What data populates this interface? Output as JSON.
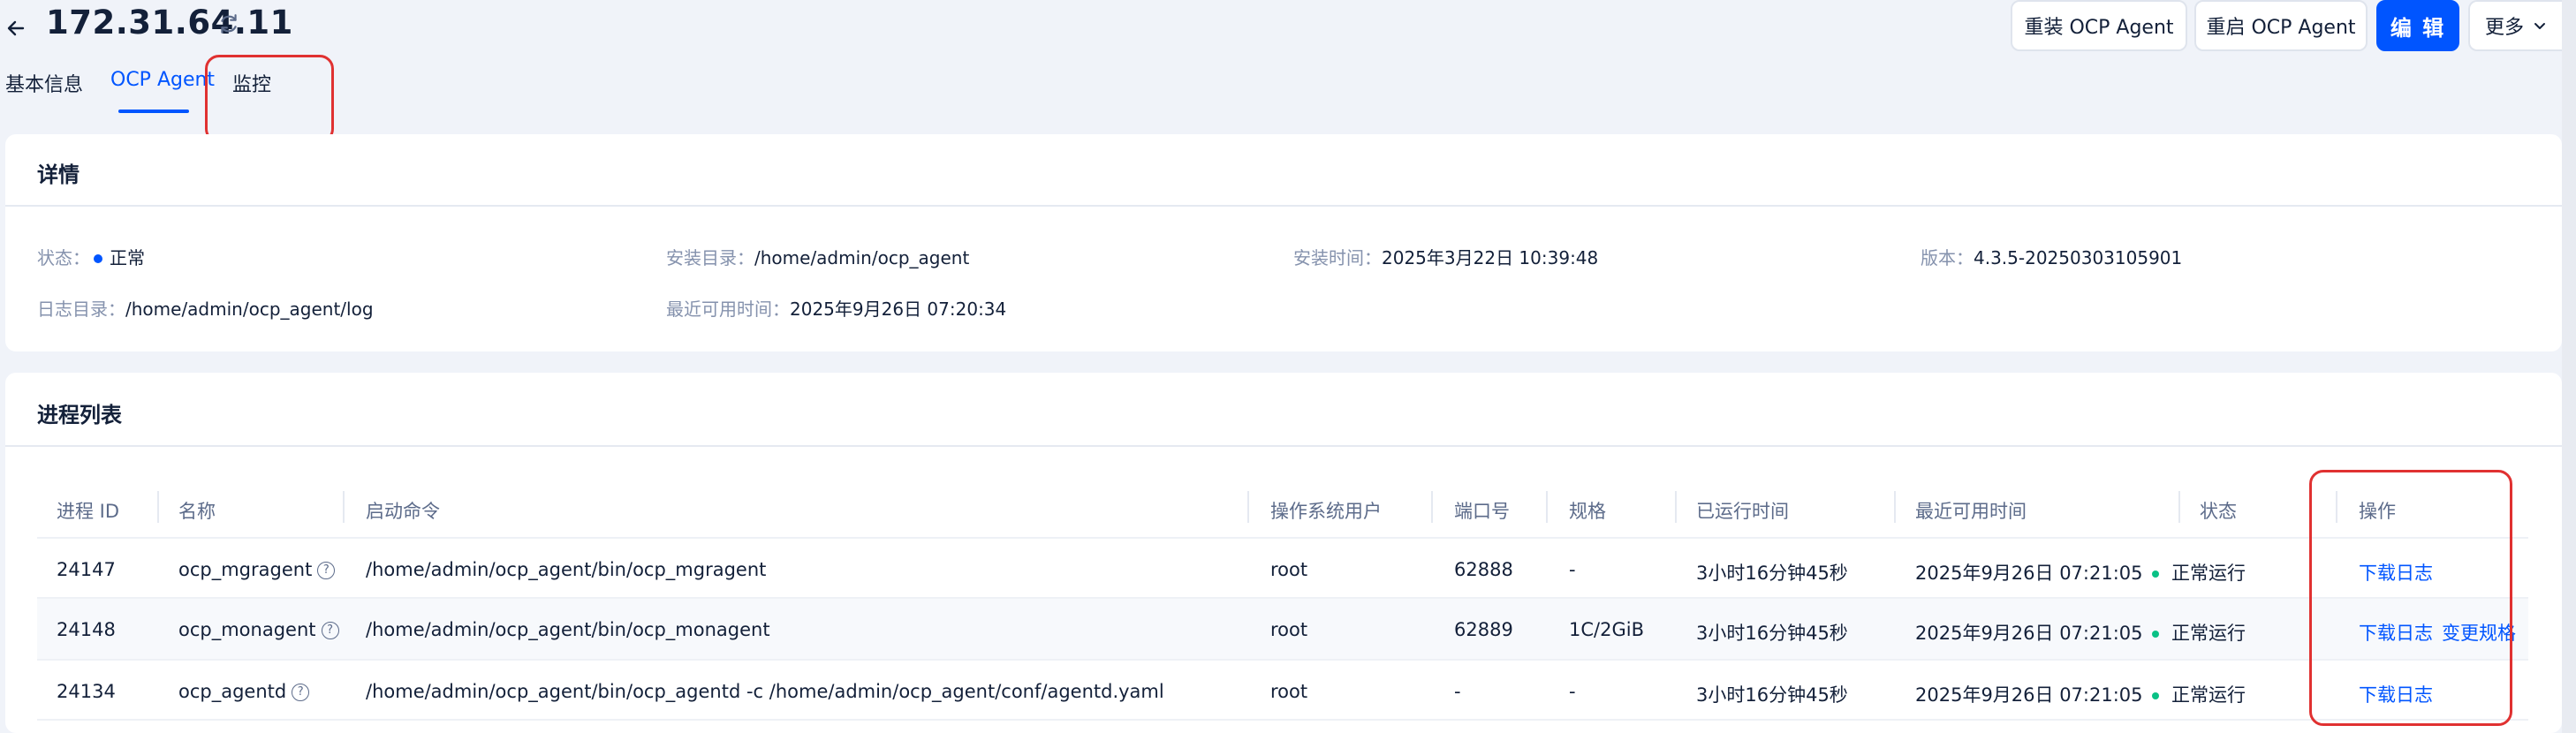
{
  "header": {
    "title": "172.31.64.11",
    "buttons": {
      "reinstall": "重装 OCP Agent",
      "restart": "重启 OCP Agent",
      "edit": "编 辑",
      "more": "更多"
    }
  },
  "tabs": [
    "基本信息",
    "OCP Agent",
    "监控"
  ],
  "details": {
    "title": "详情",
    "status_label": "状态：",
    "status_value": "正常",
    "install_dir_label": "安装目录：",
    "install_dir_value": "/home/admin/ocp_agent",
    "install_time_label": "安装时间：",
    "install_time_value": "2025年3月22日 10:39:48",
    "version_label": "版本：",
    "version_value": "4.3.5-20250303105901",
    "log_dir_label": "日志目录：",
    "log_dir_value": "/home/admin/ocp_agent/log",
    "last_available_label": "最近可用时间：",
    "last_available_value": "2025年9月26日 07:20:34"
  },
  "process_list": {
    "title": "进程列表",
    "columns": [
      "进程 ID",
      "名称",
      "启动命令",
      "操作系统用户",
      "端口号",
      "规格",
      "已运行时间",
      "最近可用时间",
      "状态",
      "操作"
    ],
    "rows": [
      {
        "pid": "24147",
        "name": "ocp_mgragent",
        "command": "/home/admin/ocp_agent/bin/ocp_mgragent",
        "user": "root",
        "port": "62888",
        "spec": "-",
        "uptime": "3小时16分钟45秒",
        "last_available": "2025年9月26日 07:21:05",
        "status": "正常运行",
        "actions": [
          "下载日志"
        ]
      },
      {
        "pid": "24148",
        "name": "ocp_monagent",
        "command": "/home/admin/ocp_agent/bin/ocp_monagent",
        "user": "root",
        "port": "62889",
        "spec": "1C/2GiB",
        "uptime": "3小时16分钟45秒",
        "last_available": "2025年9月26日 07:21:05",
        "status": "正常运行",
        "actions": [
          "下载日志",
          "变更规格"
        ]
      },
      {
        "pid": "24134",
        "name": "ocp_agentd",
        "command": "/home/admin/ocp_agent/bin/ocp_agentd -c /home/admin/ocp_agent/conf/agentd.yaml",
        "user": "root",
        "port": "-",
        "spec": "-",
        "uptime": "3小时16分钟45秒",
        "last_available": "2025年9月26日 07:21:05",
        "status": "正常运行",
        "actions": [
          "下载日志"
        ]
      }
    ]
  },
  "icons": {
    "back": "arrow-left-icon",
    "refresh": "refresh-icon",
    "help": "question-circle-icon",
    "more": "chevron-down-icon"
  },
  "colors": {
    "primary": "#0055ff",
    "success": "#0ac185",
    "highlight": "#e03131",
    "background": "#f0f3f9"
  }
}
